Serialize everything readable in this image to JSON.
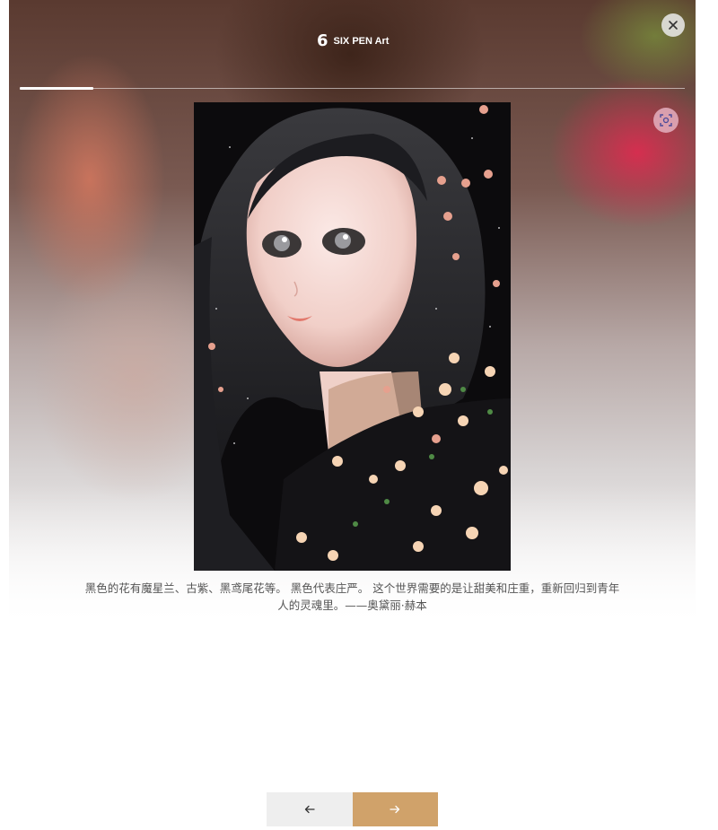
{
  "header": {
    "brand_logo": "6",
    "brand_name": "SIX PEN Art"
  },
  "progress": {
    "current_fraction": 0.11
  },
  "artwork": {
    "caption": "黑色的花有魔星兰、古紫、黑鸢尾花等。 黑色代表庄严。 这个世界需要的是让甜美和庄重，重新回归到青年人的灵魂里。——奥黛丽·赫本"
  },
  "icons": {
    "close": "close-icon",
    "scan": "scan-icon",
    "prev": "arrow-left-icon",
    "next": "arrow-right-icon"
  },
  "colors": {
    "accent": "#d0a26a",
    "prev_button_bg": "#eeeeee",
    "scan_button_bg": "#e1aab9"
  }
}
